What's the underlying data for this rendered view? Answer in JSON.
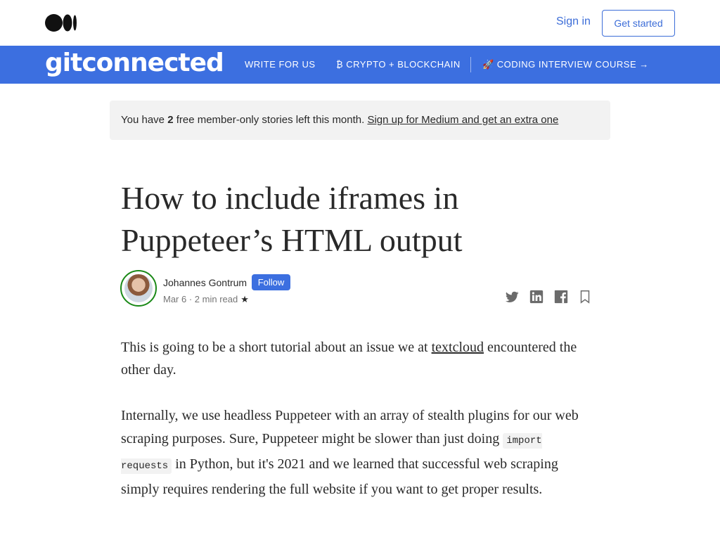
{
  "topbar": {
    "signin_label": "Sign in",
    "get_started_label": "Get started"
  },
  "publication": {
    "logo_text": "gitconnected",
    "nav": [
      {
        "label": "WRITE FOR US"
      },
      {
        "label": "₿ CRYPTO + BLOCKCHAIN"
      },
      {
        "label": "🚀 CODING INTERVIEW COURSE →"
      }
    ]
  },
  "banner": {
    "prefix": "You have ",
    "count": "2",
    "middle": " free member-only stories left this month. ",
    "link": "Sign up for Medium and get an extra one"
  },
  "article": {
    "title": "How to include iframes in Puppeteer’s HTML output",
    "author": "Johannes Gontrum",
    "follow_label": "Follow",
    "date": "Mar 6",
    "separator": " · ",
    "read_time": "2 min read",
    "star": "★",
    "p1_before": "This is going to be a short tutorial about an issue we at ",
    "p1_link": "textcloud",
    "p1_after": " encountered the other day.",
    "p2_before": "Internally, we use headless Puppeteer with an array of stealth plugins for our web scraping purposes. Sure, Puppeteer might be slower than just doing ",
    "p2_code": "import requests",
    "p2_after": " in Python, but it's 2021 and we learned that successful web scraping simply requires rendering the full website if you want to get proper results."
  },
  "social_icons": [
    "twitter-icon",
    "linkedin-icon",
    "facebook-icon",
    "bookmark-icon"
  ],
  "colors": {
    "brand_blue": "#3c6fe0",
    "link_blue": "#3c6dd8",
    "text": "#292929",
    "muted": "#757575",
    "avatar_ring": "#1a8917"
  }
}
